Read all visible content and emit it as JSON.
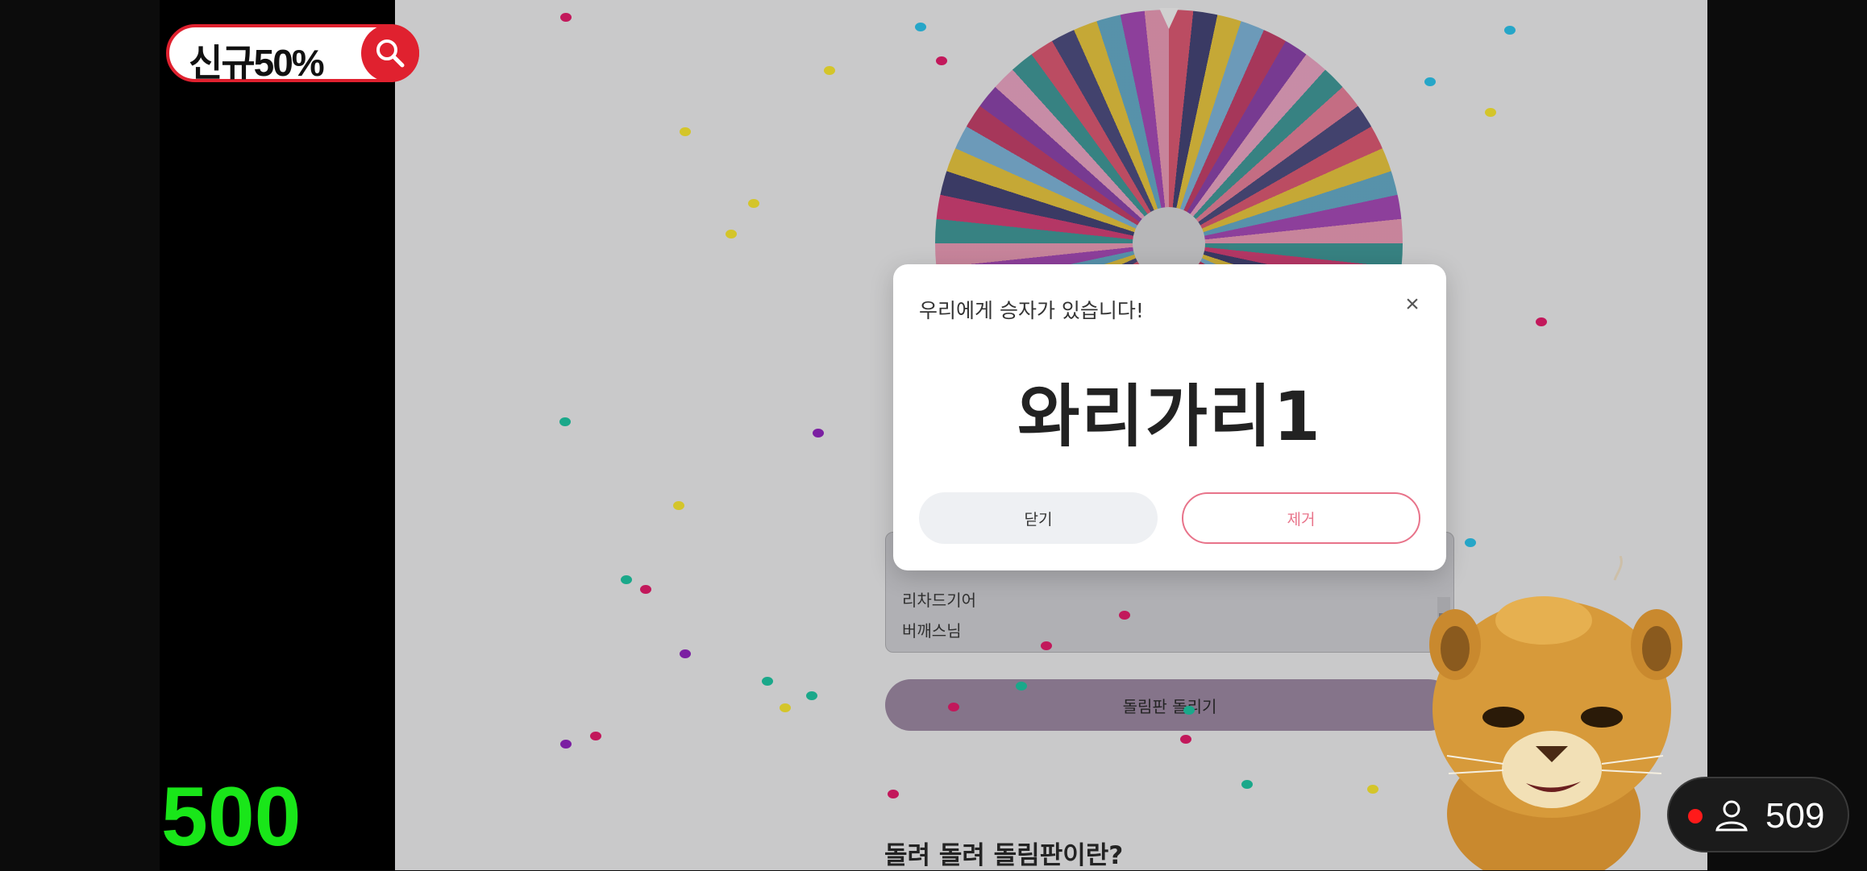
{
  "overlay": {
    "search_label": "신규50%",
    "score": "500",
    "viewer_count": "509"
  },
  "wheel": {
    "entries_visible": [
      "리차드기어",
      "버깨스님"
    ],
    "spin_label": "돌림판 돌리기",
    "about_heading": "돌려 돌려 돌림판이란?"
  },
  "modal": {
    "title": "우리에게 승자가 있습니다!",
    "close_symbol": "×",
    "winner": "와리가리1",
    "close_button": "닫기",
    "remove_button": "제거"
  },
  "colors": {
    "score_green": "#19e619",
    "search_red": "#e0212f",
    "remove_pink": "#e8738a",
    "spin_purple": "#9f8aa6"
  },
  "icons": [
    "search-icon",
    "close-icon",
    "person-icon",
    "record-dot-icon"
  ]
}
